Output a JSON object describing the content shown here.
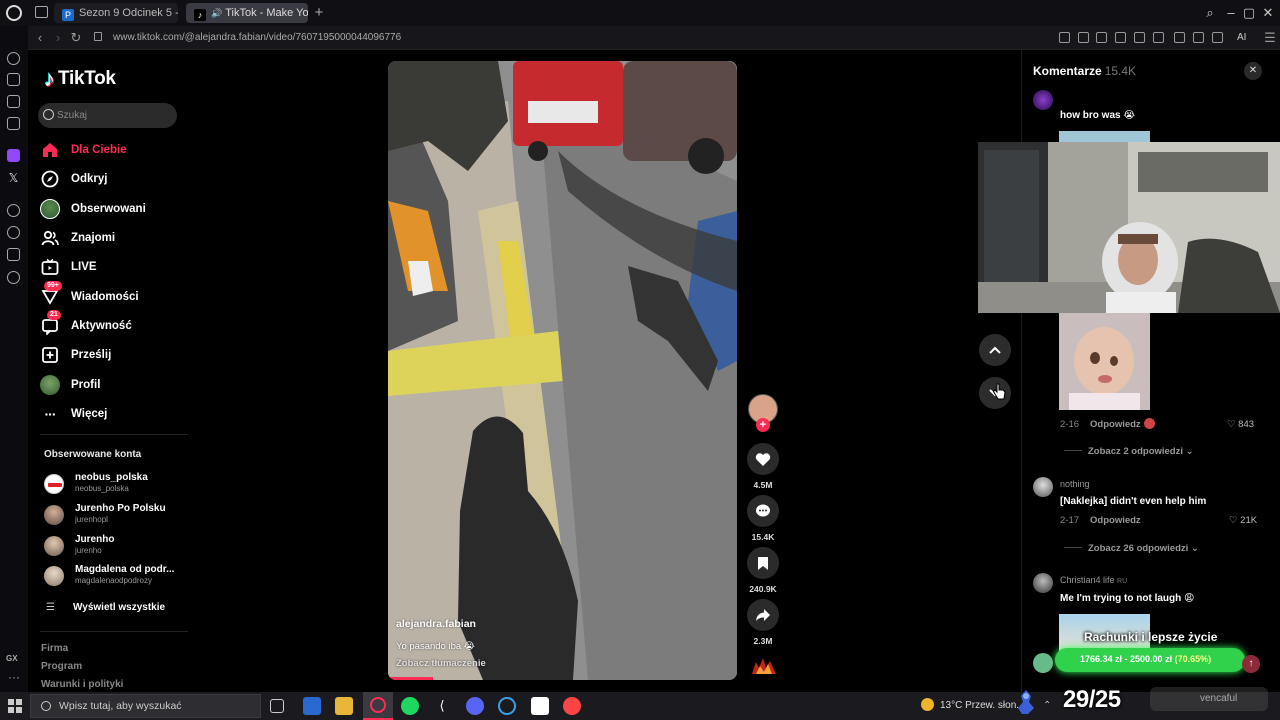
{
  "browser": {
    "tabs": [
      {
        "label": "Sezon 9 Odcinek 5 - prog",
        "favicon": "P"
      },
      {
        "label": "TikTok - Make Your Da",
        "favicon": "♪"
      }
    ],
    "url": "www.tiktok.com/@alejandra.fabian/video/7607195000044096776",
    "ai_label": "AI"
  },
  "tiktok": {
    "logo": "TikTok",
    "search_placeholder": "Szukaj",
    "nav": [
      {
        "label": "Dla Ciebie",
        "icon": "home-icon",
        "active": true
      },
      {
        "label": "Odkryj",
        "icon": "compass-icon"
      },
      {
        "label": "Obserwowani",
        "icon": "following-avatar-icon"
      },
      {
        "label": "Znajomi",
        "icon": "friends-icon"
      },
      {
        "label": "LIVE",
        "icon": "live-icon"
      },
      {
        "label": "Wiadomości",
        "icon": "messages-icon",
        "badge": "99+"
      },
      {
        "label": "Aktywność",
        "icon": "activity-icon",
        "badge": "21"
      },
      {
        "label": "Prześlij",
        "icon": "upload-icon"
      },
      {
        "label": "Profil",
        "icon": "profile-avatar-icon"
      },
      {
        "label": "Więcej",
        "icon": "more-icon"
      }
    ],
    "following_title": "Obserwowane konta",
    "following": [
      {
        "name": "neobus_polska",
        "handle": "neobus_polska"
      },
      {
        "name": "Jurenho Po Polsku",
        "handle": "jurenhopl"
      },
      {
        "name": "Jurenho",
        "handle": "jurenho"
      },
      {
        "name": "Magdalena od podr...",
        "handle": "magdalenaodpodrozy"
      }
    ],
    "see_all": "Wyświetl wszystkie",
    "footer": [
      "Firma",
      "Program",
      "Warunki i polityki"
    ]
  },
  "video": {
    "author": "alejandra.fabian",
    "description": "Yo pasando iba 😭",
    "translate": "Zobacz tłumaczenie",
    "progress_fraction": 0.13,
    "likes": "4.5M",
    "comments": "15.4K",
    "saves": "240.9K",
    "shares": "2.3M"
  },
  "comments_panel": {
    "title": "Komentarze",
    "count": "15.4K",
    "items": [
      {
        "text": "how bro was 😭"
      },
      {
        "date": "2-16",
        "reply": "Odpowiedz",
        "likes": "843",
        "more": "Zobacz 2 odpowiedzi"
      },
      {
        "user": "nothing",
        "text": "[Naklejka] didn't even help him",
        "date": "2-17",
        "reply": "Odpowiedz",
        "likes": "21K",
        "more": "Zobacz 26 odpowiedzi"
      },
      {
        "user": "Christian4 life",
        "user_tag": "RU",
        "text": "Me I'm trying to not laugh 😩"
      }
    ]
  },
  "overlay": {
    "goal_title": "Rachunki i lepsze życie",
    "goal_amount": "1766.34 zł - 2500.00 zł",
    "goal_percent": "(70.65%)",
    "counter": "29/25",
    "streamer_tag": "vencaful"
  },
  "taskbar": {
    "search_placeholder": "Wpisz tutaj, aby wyszukać",
    "weather": "13°C  Przew. słon."
  },
  "colors": {
    "accent": "#fe2c55",
    "goal_green": "#2fd24a"
  }
}
